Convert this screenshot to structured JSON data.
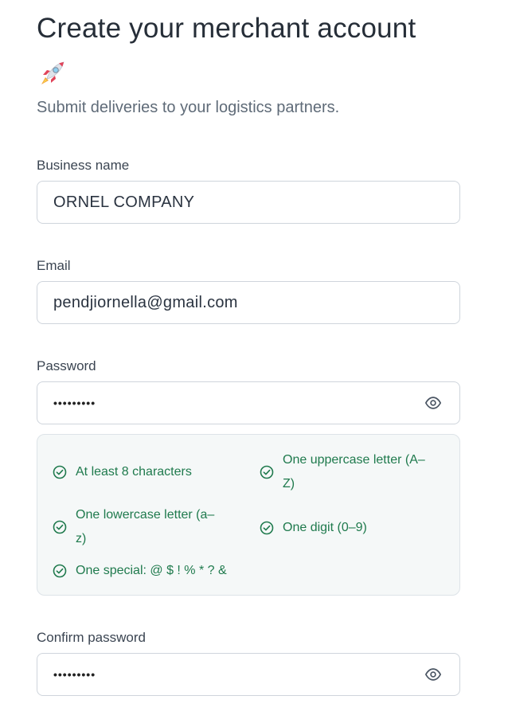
{
  "header": {
    "title": "Create your merchant account",
    "subtitle": "Submit deliveries to your logistics partners.",
    "decor_icon": "rocket-icon"
  },
  "form": {
    "business_name": {
      "label": "Business name",
      "value": "ORNEL COMPANY"
    },
    "email": {
      "label": "Email",
      "value": "pendjiornella@gmail.com"
    },
    "password": {
      "label": "Password",
      "masked_value": "•••••••••",
      "toggle_icon": "eye-icon"
    },
    "password_rules": [
      {
        "text_line1": "At least 8 characters",
        "text_line2": "",
        "icon": "check-circle-icon",
        "met": true
      },
      {
        "text_line1": "One uppercase letter (A–",
        "text_line2": "Z)",
        "icon": "check-circle-icon",
        "met": true
      },
      {
        "text_line1": "One lowercase letter (a–",
        "text_line2": "z)",
        "icon": "check-circle-icon",
        "met": true
      },
      {
        "text_line1": "One digit (0–9)",
        "text_line2": "",
        "icon": "check-circle-icon",
        "met": true
      },
      {
        "text_line1": "One special: @ $ ! % * ? &",
        "text_line2": "",
        "icon": "check-circle-icon",
        "met": true
      }
    ],
    "confirm_password": {
      "label": "Confirm password",
      "masked_value": "•••••••••",
      "toggle_icon": "eye-icon"
    }
  },
  "colors": {
    "rule_met": "#1f7a4d",
    "border": "#cfd5dc",
    "rules_panel_bg": "#f5f8f8"
  }
}
